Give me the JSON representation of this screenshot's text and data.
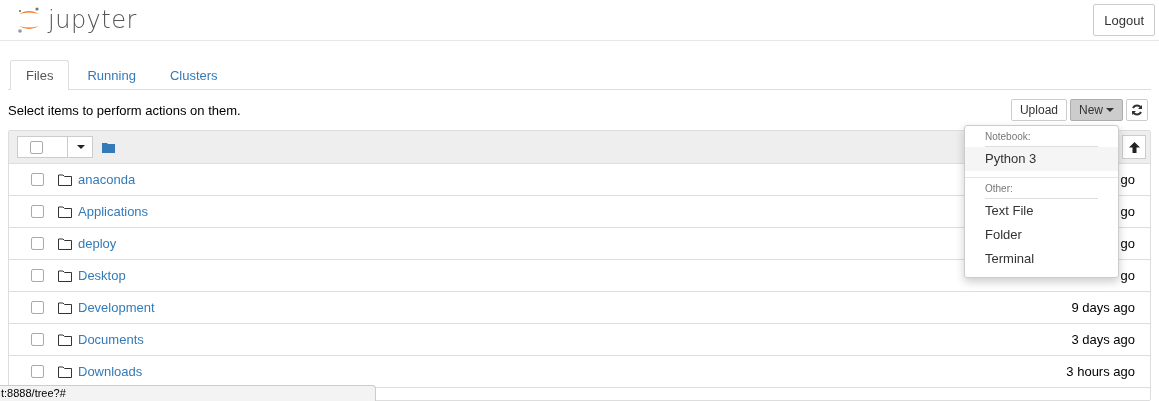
{
  "header": {
    "logo_text": "jupyter",
    "logout": "Logout"
  },
  "tabs": [
    {
      "label": "Files",
      "selected": true
    },
    {
      "label": "Running",
      "selected": false
    },
    {
      "label": "Clusters",
      "selected": false
    }
  ],
  "toolbar": {
    "hint": "Select items to perform actions on them.",
    "upload": "Upload",
    "new": "New",
    "new_open": true
  },
  "new_menu": [
    {
      "kind": "header",
      "label": "Notebook:"
    },
    {
      "kind": "item",
      "label": "Python 3",
      "selected": true
    },
    {
      "kind": "divider"
    },
    {
      "kind": "header",
      "label": "Other:"
    },
    {
      "kind": "item",
      "label": "Text File",
      "selected": false
    },
    {
      "kind": "item",
      "label": "Folder",
      "selected": false
    },
    {
      "kind": "item",
      "label": "Terminal",
      "selected": false
    }
  ],
  "rows": [
    {
      "name": "anaconda",
      "modified": "go",
      "checked": false
    },
    {
      "name": "Applications",
      "modified": "go",
      "checked": false
    },
    {
      "name": "deploy",
      "modified": "go",
      "checked": false
    },
    {
      "name": "Desktop",
      "modified": "go",
      "checked": false
    },
    {
      "name": "Development",
      "modified": "9 days ago",
      "checked": false
    },
    {
      "name": "Documents",
      "modified": "3 days ago",
      "checked": false
    },
    {
      "name": "Downloads",
      "modified": "3 hours ago",
      "checked": false
    }
  ],
  "status_url": "t:8888/tree?#"
}
